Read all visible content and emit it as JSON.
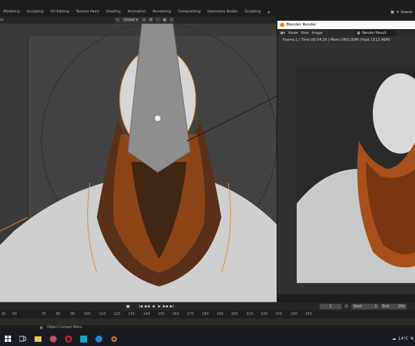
{
  "workspace_tabs": [
    "Modeling",
    "Sculpting",
    "UV Editing",
    "Texture Paint",
    "Shading",
    "Animation",
    "Rendering",
    "Compositing",
    "Geometry Nodes",
    "Scripting"
  ],
  "add_workspace": "+",
  "scene": {
    "name": "Scene"
  },
  "viewport": {
    "mode_label": "ct",
    "transform_orientation": "Global"
  },
  "render_window": {
    "title": "Blender Render",
    "menu": [
      "View",
      "View",
      "Image"
    ],
    "result_label": "Render Result",
    "status": "Frame:1 | Time:00:04.26 | Mem:1451.90M (Peak 1513.46M)"
  },
  "timeline": {
    "current_frame": "1",
    "start_label": "Start",
    "start_value": "1",
    "end_label": "End",
    "end_value": "250",
    "ticks": [
      "10",
      "50",
      "70",
      "80",
      "90",
      "100",
      "110",
      "120",
      "130",
      "140",
      "150",
      "160",
      "170",
      "180",
      "190",
      "200",
      "210",
      "220",
      "230",
      "240",
      "250"
    ]
  },
  "status_bar": {
    "text": "Object Context Menu"
  },
  "taskbar": {
    "temperature": "14°C",
    "tray_cut": "N"
  },
  "colors": {
    "accent_orange": "#e87d0d",
    "bg_dark": "#1d1d1d",
    "panel": "#303030"
  }
}
